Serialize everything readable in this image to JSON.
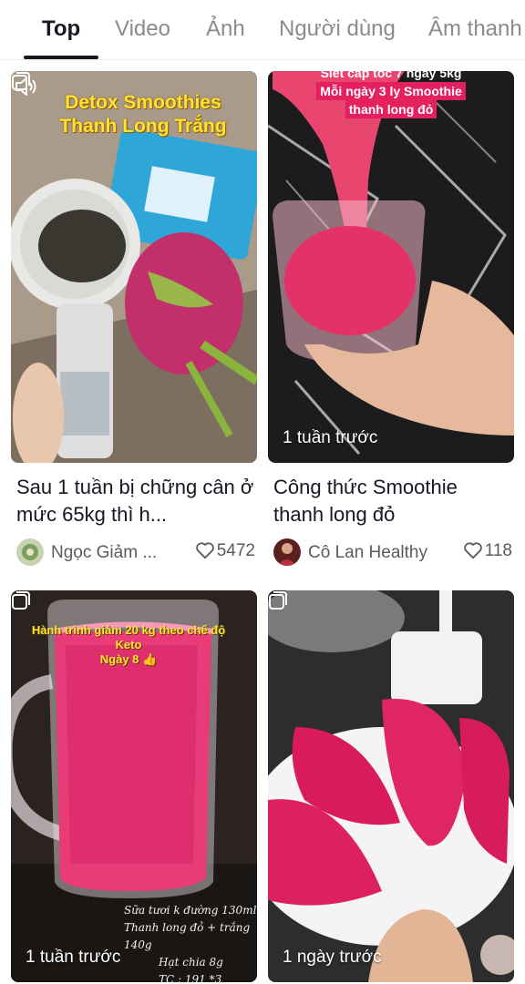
{
  "tabs": [
    {
      "label": "Top",
      "active": true
    },
    {
      "label": "Video",
      "active": false
    },
    {
      "label": "Ảnh",
      "active": false
    },
    {
      "label": "Người dùng",
      "active": false
    },
    {
      "label": "Âm thanh",
      "active": false
    }
  ],
  "cards": [
    {
      "overlay_lines": [
        "Detox Smoothies",
        "Thanh Long Trắng"
      ],
      "timestamp": "",
      "has_sound_icon": true,
      "caption": "Sau 1 tuần bị chững cân ở mức 65kg thì h...",
      "author": "Ngọc Giảm ...",
      "likes": "5472"
    },
    {
      "overlay_lines": [
        "Siết cấp tốc 7 ngày 5kg",
        "Mỗi ngày 3 ly Smoothie",
        "thanh long đỏ"
      ],
      "timestamp": "1 tuần trước",
      "has_sound_icon": false,
      "caption": "Công thức Smoothie thanh long đỏ",
      "author": "Cô Lan Healthy",
      "likes": "118"
    },
    {
      "overlay_lines": [
        "Hành trình giảm 20 kg theo chế độ",
        "Keto",
        "Ngày 8 👍"
      ],
      "bottom_lines": [
        "Sữa tươi k đường 130ml",
        "Thanh long đỏ + trắng 140g",
        "Hạt chia 8g",
        "TC : 191 *3"
      ],
      "timestamp": "1 tuần trước",
      "has_sound_icon": false
    },
    {
      "overlay_lines": [],
      "timestamp": "1 ngày trước",
      "has_sound_icon": false
    }
  ],
  "colors": {
    "text_primary": "#161823",
    "text_secondary": "#8a8b91",
    "dragonfruit_pink": "#e4205f",
    "overlay_yellow": "#ffe234"
  }
}
